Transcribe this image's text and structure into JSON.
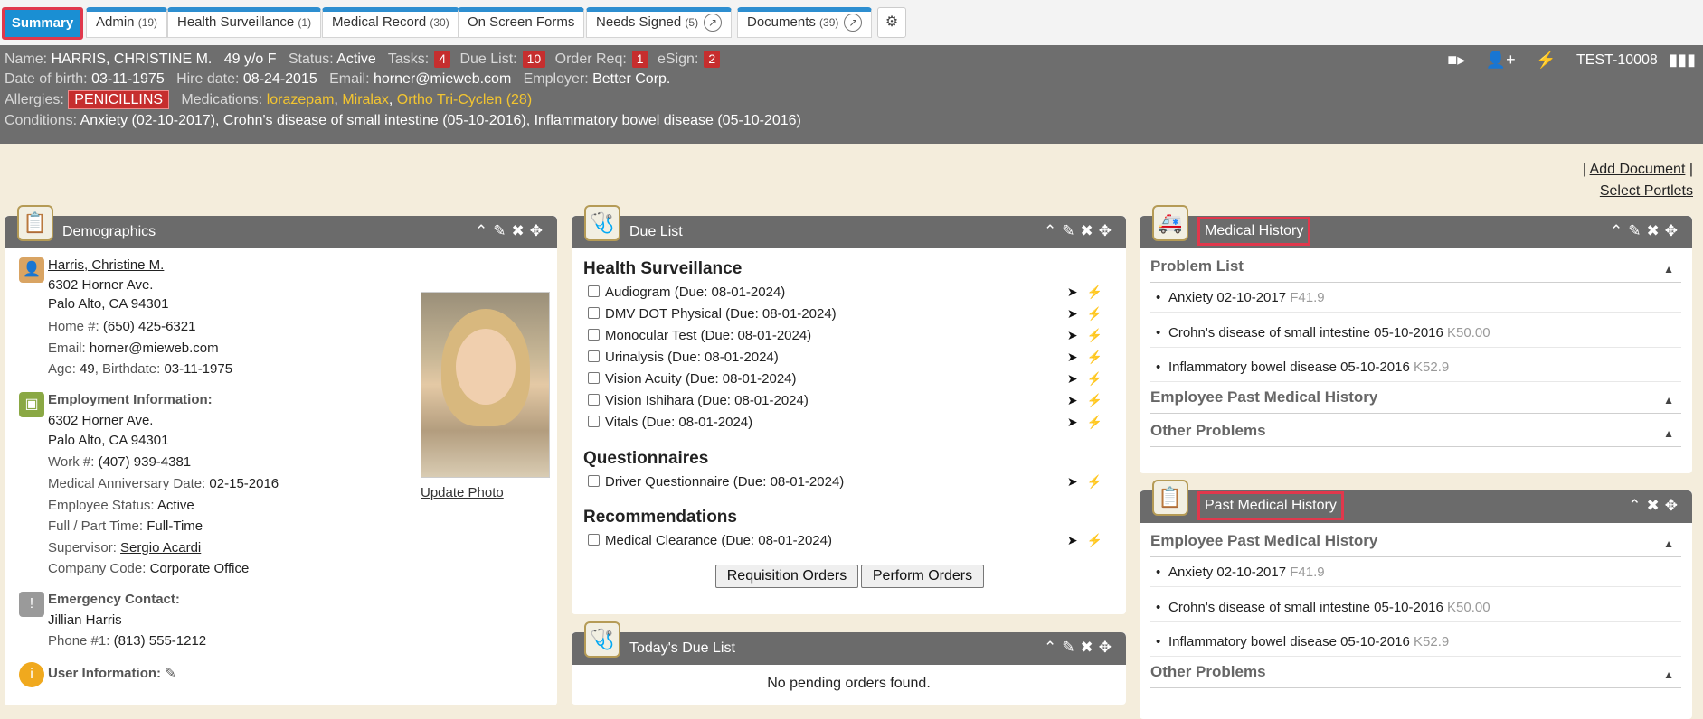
{
  "tabs": [
    {
      "label": "Summary",
      "active": true
    },
    {
      "label": "Admin",
      "count": "(19)"
    },
    {
      "label": "Health Surveillance",
      "count": "(1)"
    },
    {
      "label": "Medical Record",
      "count": "(30)"
    },
    {
      "label": "On Screen Forms",
      "count": ""
    },
    {
      "label": "Needs Signed",
      "count": "(5)"
    },
    {
      "label": "Documents",
      "count": "(39)"
    }
  ],
  "banner": {
    "name_label": "Name:",
    "name": "HARRIS, CHRISTINE M.",
    "age_sex": "49 y/o F",
    "status_label": "Status:",
    "status": "Active",
    "tasks_label": "Tasks:",
    "tasks": "4",
    "duelist_label": "Due List:",
    "duelist": "10",
    "orderreq_label": "Order Req:",
    "orderreq": "1",
    "esign_label": "eSign:",
    "esign": "2",
    "patient_id": "TEST-10008",
    "dob_label": "Date of birth:",
    "dob": "03-11-1975",
    "hire_label": "Hire date:",
    "hire": "08-24-2015",
    "email_label": "Email:",
    "email": "horner@mieweb.com",
    "employer_label": "Employer:",
    "employer": "Better Corp.",
    "allergies_label": "Allergies:",
    "allergy": "PENICILLINS",
    "meds_label": "Medications:",
    "med1": "lorazepam",
    "med2": "Miralax",
    "med3": "Ortho Tri-Cyclen (28)",
    "conditions_label": "Conditions:",
    "conditions": "Anxiety (02-10-2017), Crohn's disease of small intestine (05-10-2016), Inflammatory bowel disease (05-10-2016)"
  },
  "links": {
    "add_document": "Add Document",
    "select_portlets": "Select Portlets"
  },
  "demographics": {
    "title": "Demographics",
    "name": "Harris, Christine M.",
    "addr1": "6302 Horner Ave.",
    "addr2": "Palo Alto, CA 94301",
    "home_label": "Home #:",
    "home": "(650) 425-6321",
    "email_label": "Email:",
    "email": "horner@mieweb.com",
    "age_label": "Age:",
    "age": "49",
    "birthdate_label": ", Birthdate:",
    "birthdate": "03-11-1975",
    "employment_heading": "Employment Information:",
    "emp_addr1": "6302 Horner Ave.",
    "emp_addr2": "Palo Alto, CA 94301",
    "work_label": "Work #:",
    "work": "(407) 939-4381",
    "anniv_label": "Medical Anniversary Date:",
    "anniv": "02-15-2016",
    "empstatus_label": "Employee Status:",
    "empstatus": "Active",
    "fullpart_label": "Full / Part Time:",
    "fullpart": "Full-Time",
    "supervisor_label": "Supervisor:",
    "supervisor": "Sergio Acardi",
    "company_label": "Company Code:",
    "company": "Corporate Office",
    "emergency_heading": "Emergency Contact:",
    "emergency_name": "Jillian Harris",
    "phone_label": "Phone #1:",
    "phone": "(813) 555-1212",
    "userinfo_heading": "User Information:",
    "update_photo": "Update Photo"
  },
  "due_list": {
    "title": "Due List",
    "hs_heading": "Health Surveillance",
    "hs_items": [
      "Audiogram (Due: 08-01-2024)",
      "DMV DOT Physical (Due: 08-01-2024)",
      "Monocular Test (Due: 08-01-2024)",
      "Urinalysis (Due: 08-01-2024)",
      "Vision Acuity (Due: 08-01-2024)",
      "Vision Ishihara (Due: 08-01-2024)",
      "Vitals (Due: 08-01-2024)"
    ],
    "q_heading": "Questionnaires",
    "q_items": [
      "Driver Questionnaire (Due: 08-01-2024)"
    ],
    "r_heading": "Recommendations",
    "r_items": [
      "Medical Clearance (Due: 08-01-2024)"
    ],
    "requisition_btn": "Requisition Orders",
    "perform_btn": "Perform Orders"
  },
  "todays_due": {
    "title": "Today's Due List",
    "empty": "No pending orders found."
  },
  "medical_history": {
    "title": "Medical History",
    "problem_list": "Problem List",
    "problems": [
      {
        "text": "Anxiety 02-10-2017",
        "code": "F41.9"
      },
      {
        "text": "Crohn's disease of small intestine 05-10-2016",
        "code": "K50.00"
      },
      {
        "text": "Inflammatory bowel disease 05-10-2016",
        "code": "K52.9"
      }
    ],
    "emp_past": "Employee Past Medical History",
    "other": "Other Problems"
  },
  "past_medical_history": {
    "title": "Past Medical History",
    "emp_past": "Employee Past Medical History",
    "items": [
      {
        "text": "Anxiety 02-10-2017",
        "code": "F41.9"
      },
      {
        "text": "Crohn's disease of small intestine 05-10-2016",
        "code": "K50.00"
      },
      {
        "text": "Inflammatory bowel disease 05-10-2016",
        "code": "K52.9"
      }
    ],
    "other": "Other Problems"
  }
}
